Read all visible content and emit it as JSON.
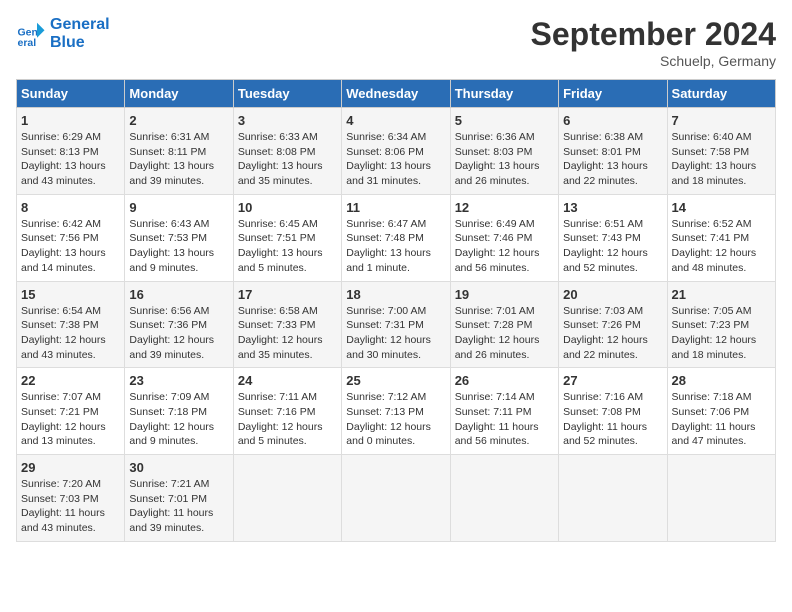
{
  "logo": {
    "line1": "General",
    "line2": "Blue"
  },
  "title": "September 2024",
  "location": "Schuelp, Germany",
  "days_of_week": [
    "Sunday",
    "Monday",
    "Tuesday",
    "Wednesday",
    "Thursday",
    "Friday",
    "Saturday"
  ],
  "weeks": [
    [
      {
        "day": 1,
        "sunrise": "6:29 AM",
        "sunset": "8:13 PM",
        "daylight": "13 hours and 43 minutes."
      },
      {
        "day": 2,
        "sunrise": "6:31 AM",
        "sunset": "8:11 PM",
        "daylight": "13 hours and 39 minutes."
      },
      {
        "day": 3,
        "sunrise": "6:33 AM",
        "sunset": "8:08 PM",
        "daylight": "13 hours and 35 minutes."
      },
      {
        "day": 4,
        "sunrise": "6:34 AM",
        "sunset": "8:06 PM",
        "daylight": "13 hours and 31 minutes."
      },
      {
        "day": 5,
        "sunrise": "6:36 AM",
        "sunset": "8:03 PM",
        "daylight": "13 hours and 26 minutes."
      },
      {
        "day": 6,
        "sunrise": "6:38 AM",
        "sunset": "8:01 PM",
        "daylight": "13 hours and 22 minutes."
      },
      {
        "day": 7,
        "sunrise": "6:40 AM",
        "sunset": "7:58 PM",
        "daylight": "13 hours and 18 minutes."
      }
    ],
    [
      {
        "day": 8,
        "sunrise": "6:42 AM",
        "sunset": "7:56 PM",
        "daylight": "13 hours and 14 minutes."
      },
      {
        "day": 9,
        "sunrise": "6:43 AM",
        "sunset": "7:53 PM",
        "daylight": "13 hours and 9 minutes."
      },
      {
        "day": 10,
        "sunrise": "6:45 AM",
        "sunset": "7:51 PM",
        "daylight": "13 hours and 5 minutes."
      },
      {
        "day": 11,
        "sunrise": "6:47 AM",
        "sunset": "7:48 PM",
        "daylight": "13 hours and 1 minute."
      },
      {
        "day": 12,
        "sunrise": "6:49 AM",
        "sunset": "7:46 PM",
        "daylight": "12 hours and 56 minutes."
      },
      {
        "day": 13,
        "sunrise": "6:51 AM",
        "sunset": "7:43 PM",
        "daylight": "12 hours and 52 minutes."
      },
      {
        "day": 14,
        "sunrise": "6:52 AM",
        "sunset": "7:41 PM",
        "daylight": "12 hours and 48 minutes."
      }
    ],
    [
      {
        "day": 15,
        "sunrise": "6:54 AM",
        "sunset": "7:38 PM",
        "daylight": "12 hours and 43 minutes."
      },
      {
        "day": 16,
        "sunrise": "6:56 AM",
        "sunset": "7:36 PM",
        "daylight": "12 hours and 39 minutes."
      },
      {
        "day": 17,
        "sunrise": "6:58 AM",
        "sunset": "7:33 PM",
        "daylight": "12 hours and 35 minutes."
      },
      {
        "day": 18,
        "sunrise": "7:00 AM",
        "sunset": "7:31 PM",
        "daylight": "12 hours and 30 minutes."
      },
      {
        "day": 19,
        "sunrise": "7:01 AM",
        "sunset": "7:28 PM",
        "daylight": "12 hours and 26 minutes."
      },
      {
        "day": 20,
        "sunrise": "7:03 AM",
        "sunset": "7:26 PM",
        "daylight": "12 hours and 22 minutes."
      },
      {
        "day": 21,
        "sunrise": "7:05 AM",
        "sunset": "7:23 PM",
        "daylight": "12 hours and 18 minutes."
      }
    ],
    [
      {
        "day": 22,
        "sunrise": "7:07 AM",
        "sunset": "7:21 PM",
        "daylight": "12 hours and 13 minutes."
      },
      {
        "day": 23,
        "sunrise": "7:09 AM",
        "sunset": "7:18 PM",
        "daylight": "12 hours and 9 minutes."
      },
      {
        "day": 24,
        "sunrise": "7:11 AM",
        "sunset": "7:16 PM",
        "daylight": "12 hours and 5 minutes."
      },
      {
        "day": 25,
        "sunrise": "7:12 AM",
        "sunset": "7:13 PM",
        "daylight": "12 hours and 0 minutes."
      },
      {
        "day": 26,
        "sunrise": "7:14 AM",
        "sunset": "7:11 PM",
        "daylight": "11 hours and 56 minutes."
      },
      {
        "day": 27,
        "sunrise": "7:16 AM",
        "sunset": "7:08 PM",
        "daylight": "11 hours and 52 minutes."
      },
      {
        "day": 28,
        "sunrise": "7:18 AM",
        "sunset": "7:06 PM",
        "daylight": "11 hours and 47 minutes."
      }
    ],
    [
      {
        "day": 29,
        "sunrise": "7:20 AM",
        "sunset": "7:03 PM",
        "daylight": "11 hours and 43 minutes."
      },
      {
        "day": 30,
        "sunrise": "7:21 AM",
        "sunset": "7:01 PM",
        "daylight": "11 hours and 39 minutes."
      },
      null,
      null,
      null,
      null,
      null
    ]
  ]
}
